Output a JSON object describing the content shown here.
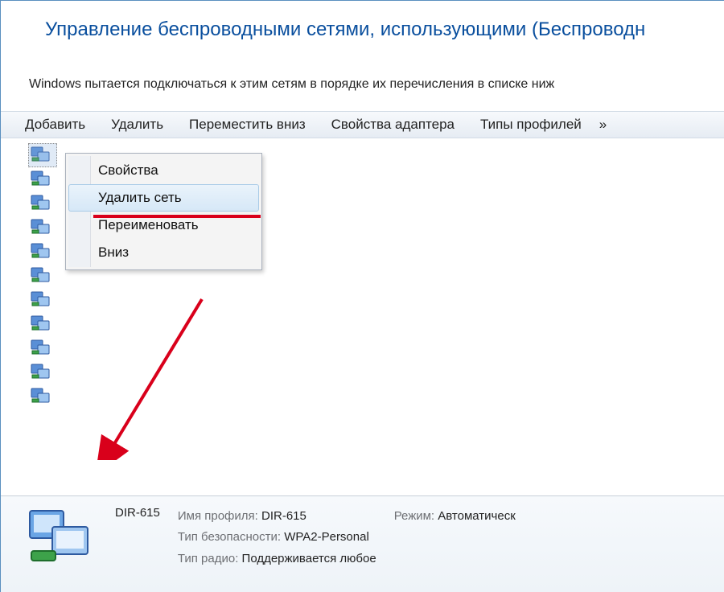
{
  "title": "Управление беспроводными сетями, использующими (Беспроводн",
  "subtitle": "Windows пытается подключаться к этим сетям в порядке их перечисления в списке ниж",
  "toolbar": {
    "add": "Добавить",
    "remove": "Удалить",
    "move_down": "Переместить вниз",
    "adapter_props": "Свойства адаптера",
    "profile_types": "Типы профилей",
    "overflow": "»"
  },
  "context_menu": {
    "properties": "Свойства",
    "delete_network": "Удалить сеть",
    "rename": "Переименовать",
    "down": "Вниз"
  },
  "details": {
    "name": "DIR-615",
    "profile_label": "Имя профиля:",
    "profile_value": "DIR-615",
    "security_label": "Тип безопасности:",
    "security_value": "WPA2-Personal",
    "radio_label": "Тип радио:",
    "radio_value": "Поддерживается любое",
    "mode_label": "Режим:",
    "mode_value": "Автоматическ"
  }
}
